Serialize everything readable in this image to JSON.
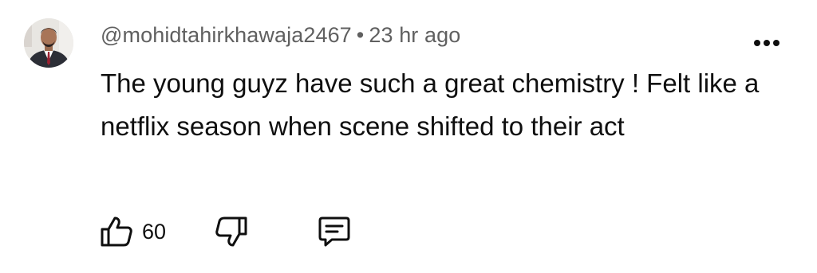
{
  "comment": {
    "author": "@mohidtahirkhawaja2467",
    "separator": "•",
    "timestamp": "23 hr ago",
    "text": "The young guyz have such a great chemistry ! Felt like a netflix season when scene shifted to their act",
    "like_count": "60"
  },
  "icons": {
    "avatar": "user-photo",
    "more": "more-options-icon",
    "like": "thumbs-up-outline-icon",
    "dislike": "thumbs-down-outline-icon",
    "reply": "comment-bubble-icon"
  },
  "colors": {
    "meta_text": "#606060",
    "body_text": "#0f0f0f",
    "background": "#ffffff"
  }
}
